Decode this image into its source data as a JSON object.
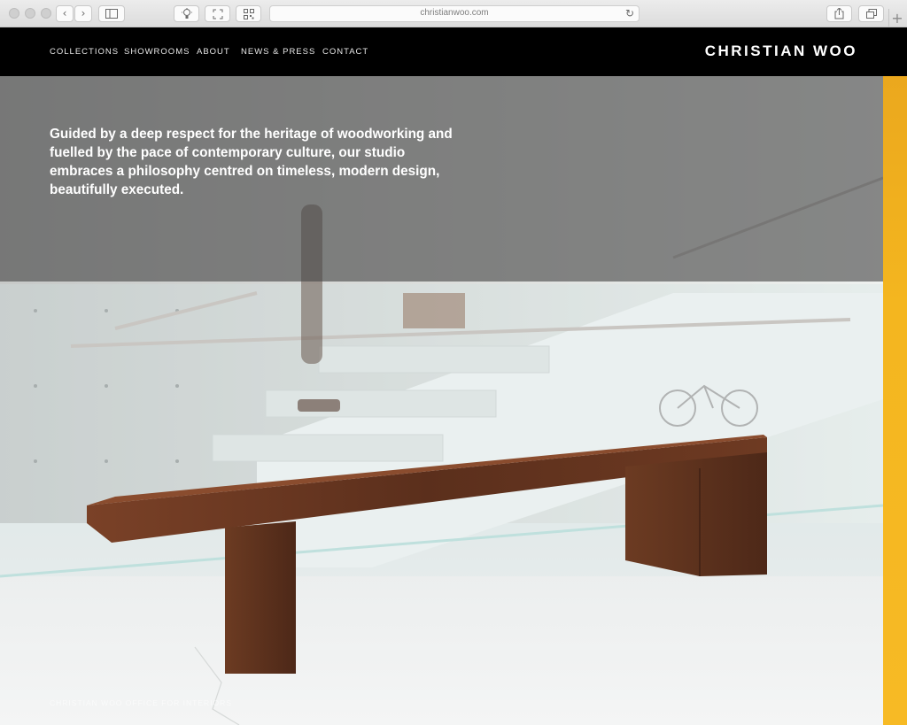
{
  "browser": {
    "url": "christianwoo.com",
    "back_glyph": "‹",
    "forward_glyph": "›",
    "reload_glyph": "↻",
    "new_tab_glyph": "+"
  },
  "site": {
    "brand": "CHRISTIAN WOO",
    "nav": [
      "COLLECTIONS",
      "SHOWROOMS",
      "ABOUT",
      "NEWS & PRESS",
      "CONTACT"
    ],
    "intro": "Guided by a deep respect for the heritage of woodworking and fuelled by the pace of contemporary culture, our studio embraces a philosophy centred on timeless, modern design, beautifully executed.",
    "caption": "CHRISTIAN WOO OFFICE FOR INTERIORS"
  },
  "colors": {
    "nav_bg": "#000000",
    "accent": "#f4b61f",
    "wood": "#6b3a22"
  }
}
